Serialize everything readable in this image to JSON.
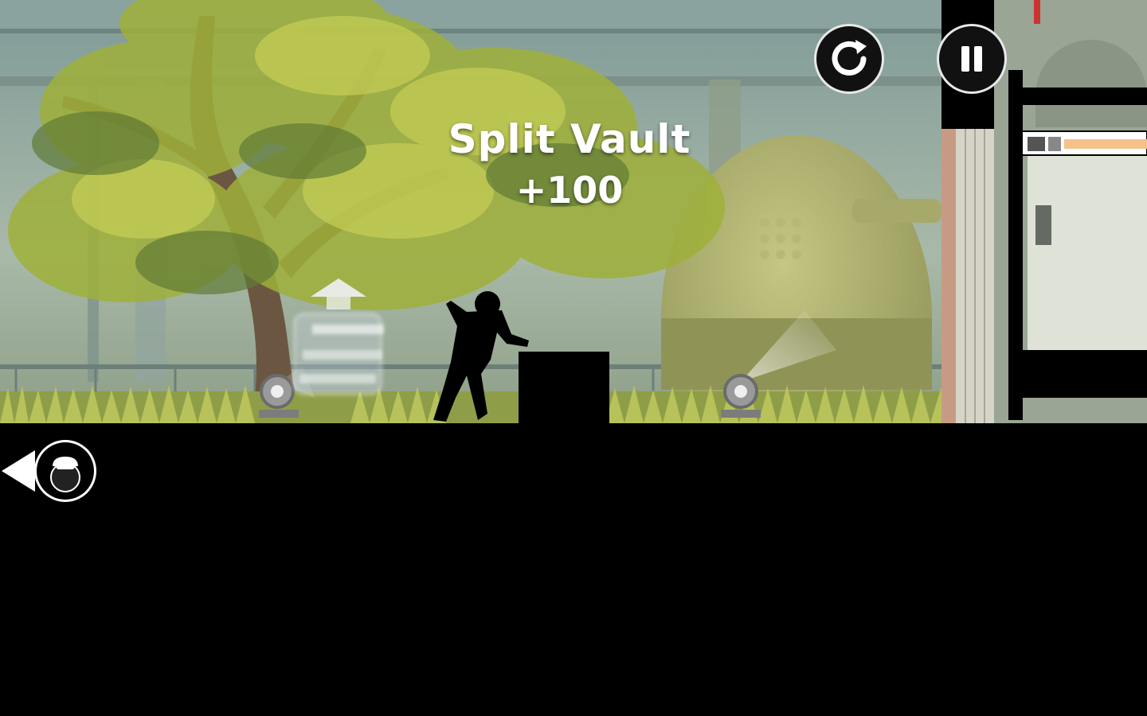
{
  "hud": {
    "restart_icon": "restart-icon",
    "pause_icon": "pause-icon",
    "back_icon": "hunter-back-icon"
  },
  "trick": {
    "name": "Split Vault",
    "score": "+100"
  },
  "colors": {
    "ui_fill": "#111111",
    "ui_stroke": "#e8e8e8",
    "foliage": "#9fb03a",
    "sky": "#8fa39a"
  }
}
